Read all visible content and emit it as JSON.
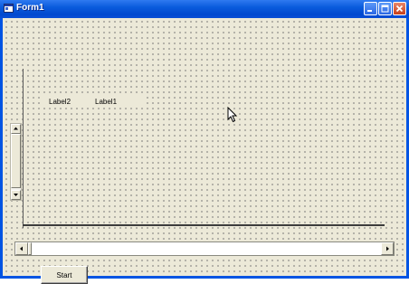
{
  "window": {
    "title": "Form1"
  },
  "labels": {
    "label2": "Label2",
    "label1": "Label1"
  },
  "buttons": {
    "start": "Start"
  },
  "colors": {
    "titlebar": "#0054e3",
    "form_background": "#ece9d8",
    "close_button": "#c63f1a"
  },
  "icons": [
    "app-icon",
    "minimize-icon",
    "maximize-icon",
    "close-icon",
    "arrow-up-icon",
    "arrow-down-icon",
    "arrow-left-icon",
    "arrow-right-icon",
    "mouse-cursor-icon"
  ]
}
